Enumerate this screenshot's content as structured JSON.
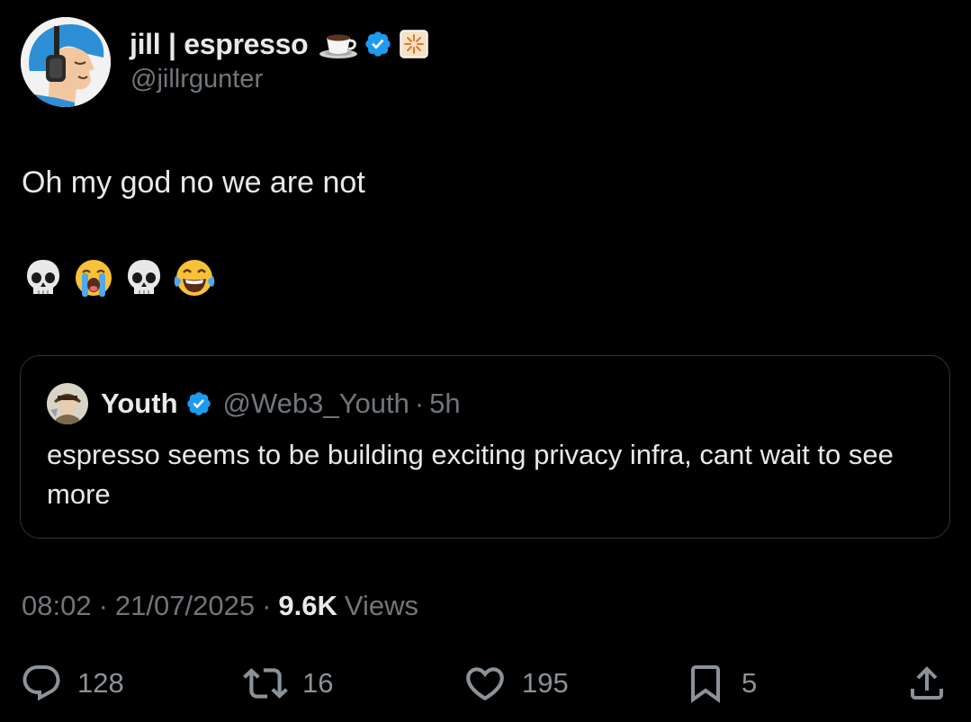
{
  "author": {
    "display_name": "jill",
    "name_separator": "|",
    "name_suffix": "espresso",
    "handle": "@jillrgunter",
    "verified": true
  },
  "tweet": {
    "text": "Oh my god no we are not",
    "emojis": [
      "skull-emoji",
      "loudly-crying-emoji",
      "skull-emoji",
      "tears-of-joy-emoji"
    ]
  },
  "quote": {
    "name": "Youth",
    "handle": "@Web3_Youth",
    "time": "5h",
    "text": "espresso seems to be building exciting privacy infra, cant wait to see more",
    "verified": true
  },
  "meta": {
    "time": "08:02",
    "date": "21/07/2025",
    "views_count": "9.6K",
    "views_label": "Views"
  },
  "actions": {
    "replies": "128",
    "reposts": "16",
    "likes": "195",
    "bookmarks": "5"
  },
  "colors": {
    "background": "#000000",
    "primary_text": "#e7e9ea",
    "secondary_text": "#71767b",
    "verified_blue": "#1d9bf0",
    "border": "#2f3336"
  }
}
